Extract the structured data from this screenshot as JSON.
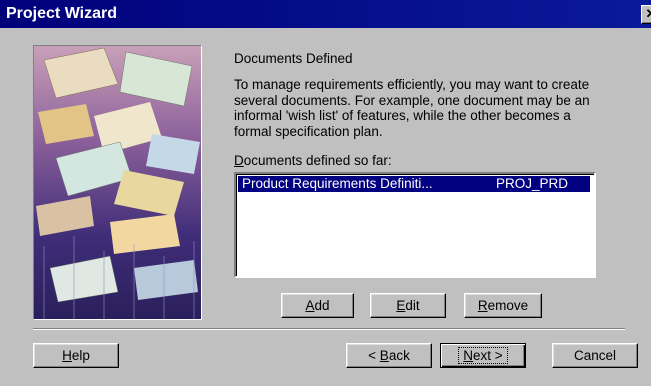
{
  "window": {
    "title": "Project Wizard",
    "close_label": "✕"
  },
  "page": {
    "heading": "Documents Defined",
    "intro": "To manage requirements efficiently, you may want to create several documents.  For example, one document may be an informal 'wish list' of features, while the other becomes a formal specification plan.",
    "list_label_prefix": "D",
    "list_label_rest": "ocuments defined so far:"
  },
  "documents": [
    {
      "name": "Product Requirements Definiti...",
      "code": "PROJ_PRD",
      "selected": true
    }
  ],
  "buttons": {
    "add": {
      "mnemonic": "A",
      "rest": "dd"
    },
    "edit": {
      "mnemonic": "E",
      "rest": "dit"
    },
    "remove": {
      "mnemonic": "R",
      "rest": "emove"
    },
    "help": {
      "mnemonic": "H",
      "rest": "elp"
    },
    "back": {
      "prefix": "< ",
      "mnemonic": "B",
      "rest": "ack"
    },
    "next": {
      "mnemonic": "N",
      "rest": "ext >"
    },
    "cancel": {
      "label": "Cancel"
    }
  },
  "colors": {
    "titlebar": "#00007a",
    "selection": "#000080",
    "face": "#c0c0c0"
  }
}
